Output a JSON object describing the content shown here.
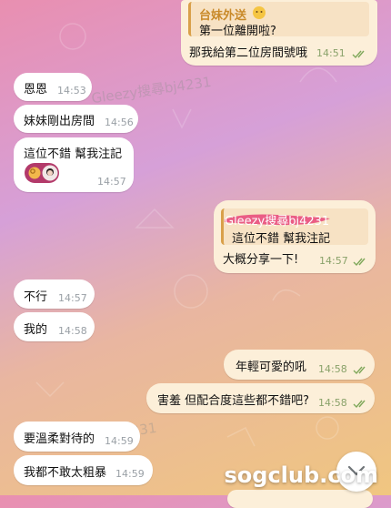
{
  "colors": {
    "accent": "#d9a04a",
    "highlight": "#e8457a",
    "tick": "#7fa85a"
  },
  "messages": [
    {
      "id": "m1",
      "side": "out",
      "quote_name": "台妹外送",
      "quote_text": "第一位離開啦?",
      "text": "那我給第二位房間號哦",
      "time": "14:51",
      "read": true
    },
    {
      "id": "m2",
      "side": "in",
      "text": "恩恩",
      "time": "14:53"
    },
    {
      "id": "m3",
      "side": "in",
      "text": "妹妹剛出房間",
      "time": "14:56"
    },
    {
      "id": "m4",
      "side": "in",
      "text": "這位不錯  幫我注記",
      "time": "14:57",
      "reaction_icon": "ok-hand-emoji"
    },
    {
      "id": "m5",
      "side": "out",
      "quote_name": "Gleezy搜尋bj4231",
      "quote_text": "這位不錯  幫我注記",
      "text": "大概分享一下!",
      "time": "14:57",
      "read": true
    },
    {
      "id": "m6",
      "side": "in",
      "text": "不行",
      "time": "14:57"
    },
    {
      "id": "m7",
      "side": "in",
      "text": "我的",
      "time": "14:58"
    },
    {
      "id": "m8",
      "side": "out",
      "text": "年輕可愛的吼",
      "time": "14:58",
      "read": true
    },
    {
      "id": "m9",
      "side": "out",
      "text": "害羞 但配合度這些都不錯吧?",
      "time": "14:58",
      "read": true
    },
    {
      "id": "m10",
      "side": "in",
      "text": "要溫柔對待的",
      "time": "14:59"
    },
    {
      "id": "m11",
      "side": "in",
      "text": "我都不敢太粗暴",
      "time": "14:59"
    }
  ],
  "watermarks": [
    "Gleezy搜尋bj4231",
    "Gleezy搜尋bj4231"
  ],
  "site_label": "sogclub.com",
  "scroll_button_icon": "chevron-down-icon"
}
